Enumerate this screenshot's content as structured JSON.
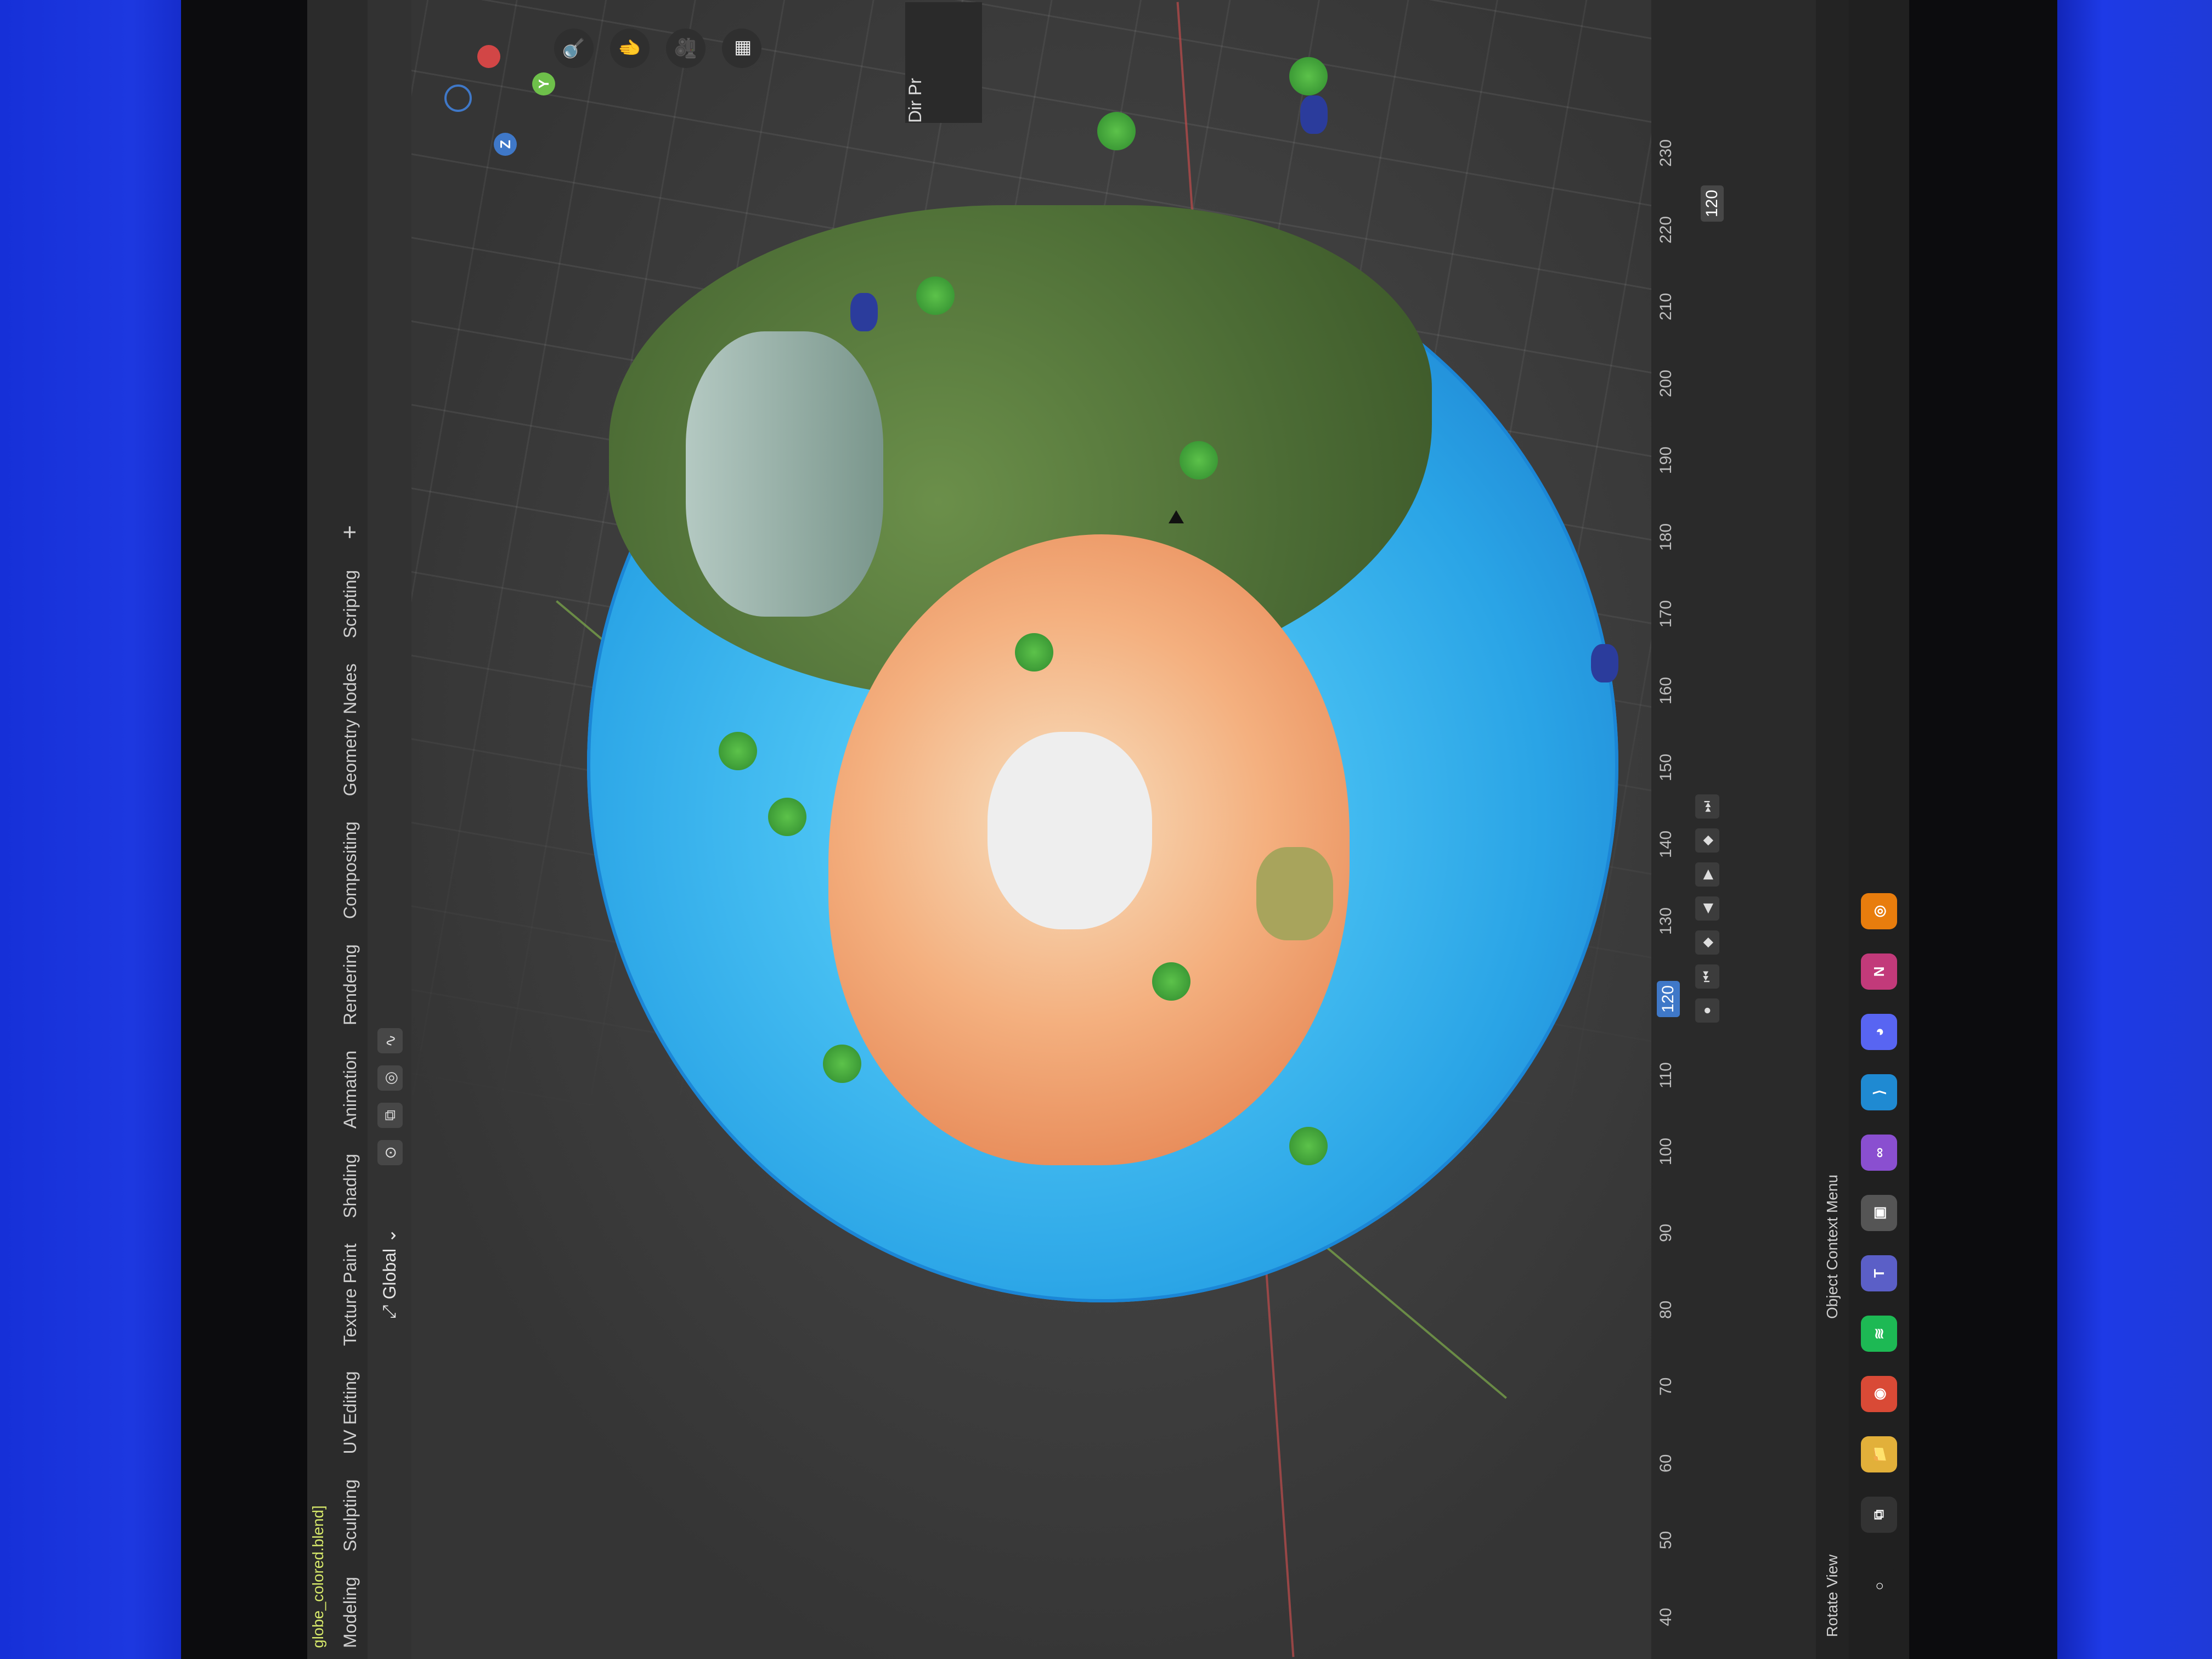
{
  "window": {
    "filename": "globe_colored.blend]"
  },
  "workspaces": [
    "Modeling",
    "Sculpting",
    "UV Editing",
    "Texture Paint",
    "Shading",
    "Animation",
    "Rendering",
    "Compositing",
    "Geometry Nodes",
    "Scripting"
  ],
  "workspace_add": "+",
  "header": {
    "transform_orientation": "Global"
  },
  "gizmo": {
    "z_label": "Z",
    "y_label": "Y"
  },
  "side_panel": {
    "label": "Dir",
    "sub": "Pr"
  },
  "timeline": {
    "frame_ticks": [
      "40",
      "50",
      "60",
      "70",
      "80",
      "90",
      "100",
      "110",
      "120",
      "130",
      "140",
      "150",
      "160",
      "170",
      "180",
      "190",
      "200",
      "210",
      "220",
      "230"
    ],
    "current_frame": "120",
    "end_field": "120"
  },
  "status_bar": {
    "rotate_view": "Rotate View",
    "context_menu": "Object Context Menu"
  },
  "taskbar": {
    "apps": [
      "Windows",
      "Files",
      "Chrome",
      "Spotify",
      "Teams",
      "Photos",
      "Visual Studio",
      "Visual Studio Code",
      "Discord",
      "Next",
      "Blender"
    ]
  },
  "colors": {
    "ocean": "#2aa4e6",
    "land": "#4c6c35",
    "desert": "#f4b07f",
    "accent": "#3f78c8",
    "filename": "#d6e86a"
  }
}
